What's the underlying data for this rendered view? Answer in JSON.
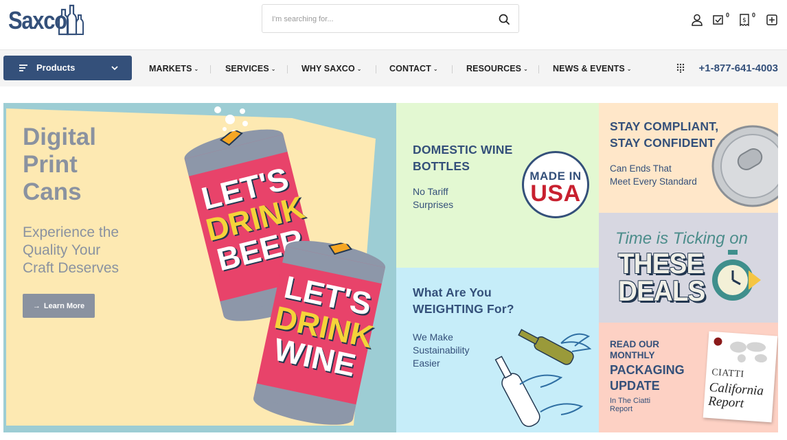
{
  "brand": {
    "logo_text": "Saxco"
  },
  "search": {
    "placeholder": "I'm searching for..."
  },
  "header_icons": {
    "wishlist_count": "0",
    "quote_count": "0"
  },
  "nav": {
    "products_label": "Products",
    "items": [
      {
        "label": "MARKETS"
      },
      {
        "label": "SERVICES"
      },
      {
        "label": "WHY SAXCO"
      },
      {
        "label": "CONTACT"
      },
      {
        "label": "RESOURCES"
      },
      {
        "label": "NEWS & EVENTS"
      }
    ],
    "phone": "+1-877-641-4003"
  },
  "hero": {
    "title_lines": [
      "Digital",
      "Print",
      "Cans"
    ],
    "subtitle_lines": [
      "Experience the",
      "Quality Your",
      "Craft Deserves"
    ],
    "button_label": "Learn More",
    "can1_lines": [
      "LET'S",
      "DRINK",
      "BEER"
    ],
    "can2_lines": [
      "LET'S",
      "DRINK",
      "WINE"
    ]
  },
  "tiles": {
    "wine": {
      "title_lines": [
        "DOMESTIC WINE",
        "BOTTLES"
      ],
      "text_lines": [
        "No Tariff",
        "Surprises"
      ],
      "badge_top": "MADE IN",
      "badge_bottom": "USA"
    },
    "weight": {
      "title_lines": [
        "What Are You",
        "WEIGHTING For?"
      ],
      "text_lines": [
        "We Make",
        "Sustainability",
        "Easier"
      ]
    },
    "comply": {
      "title_lines": [
        "STAY COMPLIANT,",
        "STAY CONFIDENT"
      ],
      "text_lines": [
        "Can Ends That",
        "Meet Every Standard"
      ]
    },
    "deals": {
      "line1": "Time is Ticking on",
      "line2a": "THESE",
      "line2b": "DEALS"
    },
    "ciatti": {
      "small_lines": [
        "READ OUR",
        "MONTHLY"
      ],
      "big_lines": [
        "PACKAGING",
        "UPDATE"
      ],
      "tiny_lines": [
        "In The Ciatti",
        "Report"
      ],
      "report_brand": "CIATTI",
      "report_title_lines": [
        "California",
        "Report"
      ]
    }
  },
  "colors": {
    "brand_navy": "#34507a",
    "usa_red": "#c8202f",
    "can_pink": "#e8436a",
    "can_yellow": "#f5d33a"
  }
}
